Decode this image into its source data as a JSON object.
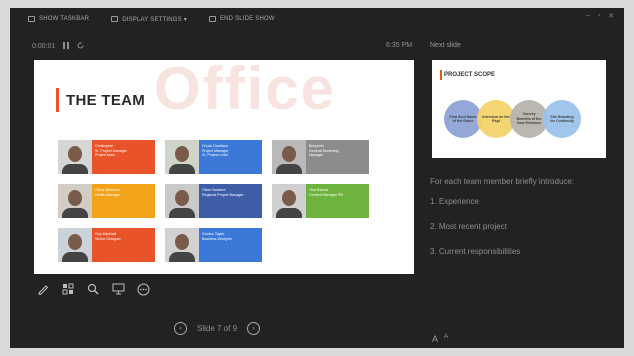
{
  "topbar": {
    "items": [
      {
        "label": "SHOW TASKBAR",
        "icon": "taskbar-icon"
      },
      {
        "label": "DISPLAY SETTINGS ▾",
        "icon": "display-settings-icon"
      },
      {
        "label": "END SLIDE SHOW",
        "icon": "end-show-icon"
      }
    ]
  },
  "timer": {
    "elapsed": "0:00:01",
    "pause_icon": "pause-icon",
    "reset_icon": "reset-icon"
  },
  "clock": "6:35 PM",
  "next_slide_label": "Next slide",
  "current_slide": {
    "watermark": "Office",
    "title": "THE TEAM",
    "members": [
      {
        "lines": [
          "Christopher",
          "Sr. Project Manager",
          "Project team"
        ],
        "color": "#e8532a",
        "photo_bg": "#d6d6d6"
      },
      {
        "lines": [
          "Chuck Davidson",
          "Project Manager",
          "Sr. Project Lead"
        ],
        "color": "#3b78d8",
        "photo_bg": "#cfd6c9"
      },
      {
        "lines": [
          "Benjamin",
          "General Marketing",
          "Manager"
        ],
        "color": "#8c8c8c",
        "photo_bg": "#b9b9b9"
      },
      {
        "lines": [
          "Olivia Simmons",
          "Health Manager"
        ],
        "color": "#f2a31a",
        "photo_bg": "#d3ccc4"
      },
      {
        "lines": [
          "Oliver Bowlerd",
          "Regional Project Manager"
        ],
        "color": "#3d5ea6",
        "photo_bg": "#c9c9c9"
      },
      {
        "lines": [
          "Tina Ramos",
          "Content Manager PM"
        ],
        "color": "#6fb33f",
        "photo_bg": "#d0d0d0"
      },
      {
        "lines": [
          "Guy Marshall",
          "Senior Designer"
        ],
        "color": "#e8532a",
        "photo_bg": "#cbd2d8"
      },
      {
        "lines": [
          "Gordon Taylor",
          "Business Designer"
        ],
        "color": "#3b78d8",
        "photo_bg": "#d2d2d2"
      }
    ]
  },
  "next_slide": {
    "title": "PROJECT SCOPE",
    "circles": [
      {
        "text": "Find Soul Name of the Game",
        "color": "#8ea3d6"
      },
      {
        "text": "Interview on the Rspl",
        "color": "#f3d36b"
      },
      {
        "text": "Convey Benefits of the New Releases",
        "color": "#b9b3ad"
      },
      {
        "text": "Site Branding for Continuity",
        "color": "#9cc3ea"
      }
    ]
  },
  "notes": {
    "intro": "For each team member briefly introduce:",
    "items": [
      "1.   Experience",
      "2.   Most recent project",
      "3.   Current responsibilities"
    ]
  },
  "tools": [
    {
      "name": "pen-tool-icon"
    },
    {
      "name": "see-all-slides-icon"
    },
    {
      "name": "zoom-icon"
    },
    {
      "name": "black-screen-icon"
    },
    {
      "name": "more-options-icon"
    }
  ],
  "navigation": {
    "prev": "‹",
    "next": "›",
    "counter": "Slide 7 of 9"
  },
  "font_controls": {
    "decrease": "A",
    "increase": "A"
  }
}
